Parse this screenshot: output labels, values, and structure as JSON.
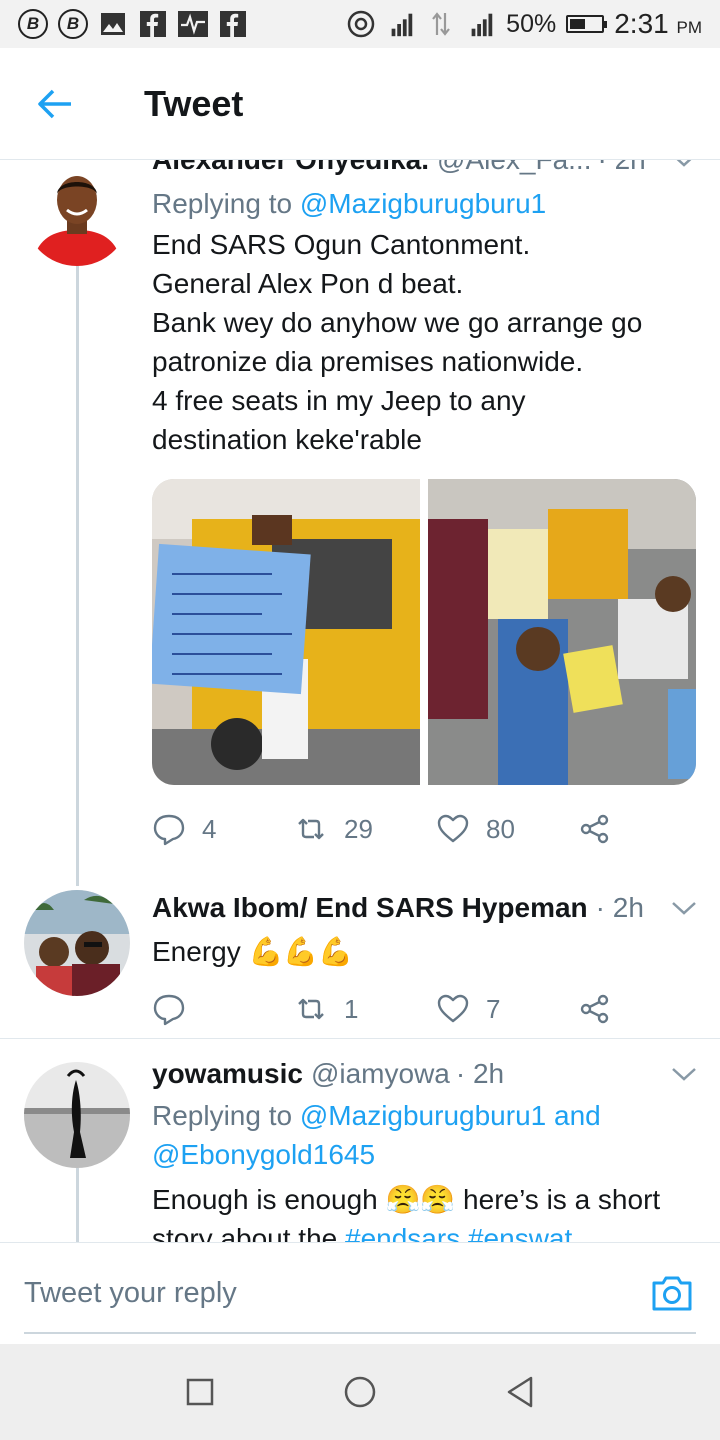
{
  "status_bar": {
    "battery": "50%",
    "time": "2:31",
    "ampm": "PM",
    "battery_level": 0.5
  },
  "header": {
    "title": "Tweet"
  },
  "tweets": [
    {
      "display_name": "Alexander Onyedika.",
      "handle": "@Alex_Fa...",
      "time": "· 2h",
      "replying_prefix": "Replying to",
      "replying_to": "@Mazigburugburu1",
      "text_lines": [
        "End SARS Ogun Cantonment.",
        "General Alex Pon d beat.",
        "Bank wey do anyhow we go arrange go",
        "patronize dia premises nationwide.",
        "4 free seats in my Jeep to any",
        "destination keke'rable"
      ],
      "replies": "4",
      "retweets": "29",
      "likes": "80"
    },
    {
      "display_name": "Akwa Ibom/ End SARS Hypeman",
      "time": "· 2h",
      "text": "Energy",
      "emoji": "💪💪💪",
      "replies": "",
      "retweets": "1",
      "likes": "7"
    },
    {
      "display_name": "yowamusic",
      "handle": "@iamyowa",
      "time": "· 2h",
      "replying_prefix": "Replying to",
      "replying_to": "@Mazigburugburu1 and",
      "replying_to_2": "@Ebonygold1645",
      "text": "Enough is enough",
      "emoji": "😤😤",
      "text_2": "here’s is a short",
      "text_3": "story about the",
      "hashtag_1": "#endsars",
      "hashtag_2": "#enswat"
    }
  ],
  "reply_bar": {
    "placeholder": "Tweet your reply"
  },
  "colors": {
    "accent": "#1da1f2",
    "secondary_text": "#657786",
    "divider": "#e1e8ed"
  }
}
